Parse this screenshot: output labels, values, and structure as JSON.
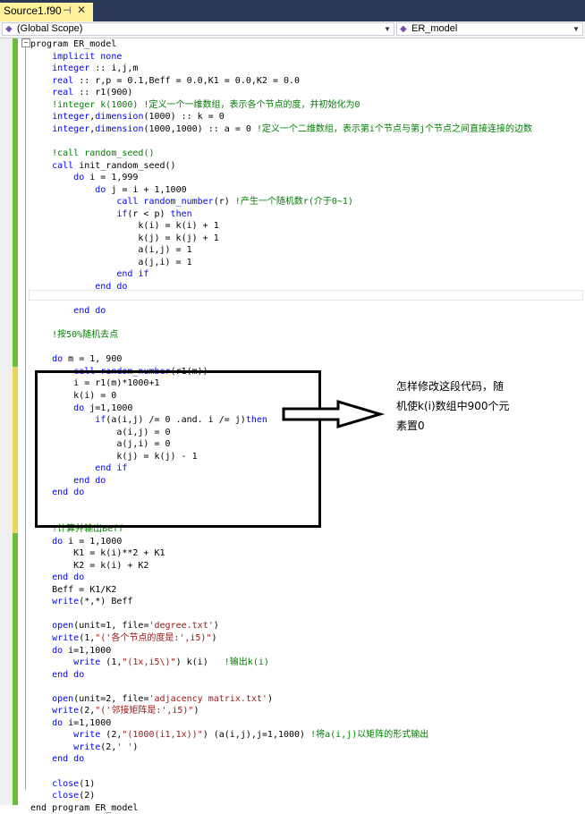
{
  "tab": {
    "title": "Source1.f90",
    "pin_glyph": "⊣",
    "close_glyph": "✕"
  },
  "scope": {
    "left": "(Global Scope)",
    "right": "ER_model"
  },
  "code_lines": [
    [
      {
        "t": "program ER_model"
      }
    ],
    [
      {
        "t": "    "
      },
      {
        "t": "implicit none",
        "c": "kw"
      }
    ],
    [
      {
        "t": "    "
      },
      {
        "t": "integer",
        "c": "kw"
      },
      {
        "t": " :: i,j,m"
      }
    ],
    [
      {
        "t": "    "
      },
      {
        "t": "real",
        "c": "kw"
      },
      {
        "t": " :: r,p = 0.1,Beff = 0.0,K1 = 0.0,K2 = 0.0"
      }
    ],
    [
      {
        "t": "    "
      },
      {
        "t": "real",
        "c": "kw"
      },
      {
        "t": " :: r1(900)"
      }
    ],
    [
      {
        "t": "    "
      },
      {
        "t": "!integer k(1000) !定义一个一维数组，表示各个节点的度，并初始化为0",
        "c": "cm"
      }
    ],
    [
      {
        "t": "    "
      },
      {
        "t": "integer",
        "c": "kw"
      },
      {
        "t": ","
      },
      {
        "t": "dimension",
        "c": "kw"
      },
      {
        "t": "(1000) :: k = 0"
      }
    ],
    [
      {
        "t": "    "
      },
      {
        "t": "integer",
        "c": "kw"
      },
      {
        "t": ","
      },
      {
        "t": "dimension",
        "c": "kw"
      },
      {
        "t": "(1000,1000) :: a = 0 "
      },
      {
        "t": "!定义一个二维数组，表示第i个节点与第j个节点之间直接连接的边数",
        "c": "cm"
      }
    ],
    [],
    [
      {
        "t": "    "
      },
      {
        "t": "!call random_seed()",
        "c": "cm"
      }
    ],
    [
      {
        "t": "    "
      },
      {
        "t": "call",
        "c": "kw"
      },
      {
        "t": " init_random_seed()"
      }
    ],
    [
      {
        "t": "        "
      },
      {
        "t": "do",
        "c": "kw"
      },
      {
        "t": " i = 1,999"
      }
    ],
    [
      {
        "t": "            "
      },
      {
        "t": "do",
        "c": "kw"
      },
      {
        "t": " j = i + 1,1000"
      }
    ],
    [
      {
        "t": "                "
      },
      {
        "t": "call random_number",
        "c": "kw"
      },
      {
        "t": "(r) "
      },
      {
        "t": "!产生一个随机数r(介于0~1)",
        "c": "cm"
      }
    ],
    [
      {
        "t": "                "
      },
      {
        "t": "if",
        "c": "kw"
      },
      {
        "t": "(r < p) "
      },
      {
        "t": "then",
        "c": "kw"
      }
    ],
    [
      {
        "t": "                    k(i) = k(i) + 1"
      }
    ],
    [
      {
        "t": "                    k(j) = k(j) + 1"
      }
    ],
    [
      {
        "t": "                    a(i,j) = 1"
      }
    ],
    [
      {
        "t": "                    a(j,i) = 1"
      }
    ],
    [
      {
        "t": "                "
      },
      {
        "t": "end if",
        "c": "kw"
      }
    ],
    [
      {
        "t": "            "
      },
      {
        "t": "end do",
        "c": "kw"
      }
    ],
    [],
    [
      {
        "t": "        "
      },
      {
        "t": "end do",
        "c": "kw"
      }
    ],
    [],
    [
      {
        "t": "    "
      },
      {
        "t": "!按50%随机去点",
        "c": "cm"
      }
    ],
    [],
    [
      {
        "t": "    "
      },
      {
        "t": "do",
        "c": "kw"
      },
      {
        "t": " m = 1, 900"
      }
    ],
    [
      {
        "t": "        "
      },
      {
        "t": "call random_number",
        "c": "kw"
      },
      {
        "t": "(r1(m))"
      }
    ],
    [
      {
        "t": "        i = r1(m)*1000+1"
      }
    ],
    [
      {
        "t": "        k(i) = 0"
      }
    ],
    [
      {
        "t": "        "
      },
      {
        "t": "do",
        "c": "kw"
      },
      {
        "t": " j=1,1000"
      }
    ],
    [
      {
        "t": "            "
      },
      {
        "t": "if",
        "c": "kw"
      },
      {
        "t": "(a(i,j) /= 0 .and. i /= j)"
      },
      {
        "t": "then",
        "c": "kw"
      }
    ],
    [
      {
        "t": "                a(i,j) = 0"
      }
    ],
    [
      {
        "t": "                a(j,i) = 0"
      }
    ],
    [
      {
        "t": "                k(j) = k(j) - 1"
      }
    ],
    [
      {
        "t": "            "
      },
      {
        "t": "end if",
        "c": "kw"
      }
    ],
    [
      {
        "t": "        "
      },
      {
        "t": "end do",
        "c": "kw"
      }
    ],
    [
      {
        "t": "    "
      },
      {
        "t": "end do",
        "c": "kw"
      }
    ],
    [],
    [],
    [
      {
        "t": "    "
      },
      {
        "t": "!计算并输出Beff",
        "c": "cm"
      }
    ],
    [
      {
        "t": "    "
      },
      {
        "t": "do",
        "c": "kw"
      },
      {
        "t": " i = 1,1000"
      }
    ],
    [
      {
        "t": "        K1 = k(i)**2 + K1"
      }
    ],
    [
      {
        "t": "        K2 = k(i) + K2"
      }
    ],
    [
      {
        "t": "    "
      },
      {
        "t": "end do",
        "c": "kw"
      }
    ],
    [
      {
        "t": "    Beff = K1/K2"
      }
    ],
    [
      {
        "t": "    "
      },
      {
        "t": "write",
        "c": "kw"
      },
      {
        "t": "(*,*) Beff"
      }
    ],
    [],
    [
      {
        "t": "    "
      },
      {
        "t": "open",
        "c": "kw"
      },
      {
        "t": "(unit=1, file="
      },
      {
        "t": "'degree.txt'",
        "c": "st"
      },
      {
        "t": ")"
      }
    ],
    [
      {
        "t": "    "
      },
      {
        "t": "write",
        "c": "kw"
      },
      {
        "t": "(1,"
      },
      {
        "t": "\"('各个节点的度是:',i5)\"",
        "c": "st"
      },
      {
        "t": ")"
      }
    ],
    [
      {
        "t": "    "
      },
      {
        "t": "do",
        "c": "kw"
      },
      {
        "t": " i=1,1000"
      }
    ],
    [
      {
        "t": "        "
      },
      {
        "t": "write",
        "c": "kw"
      },
      {
        "t": " (1,"
      },
      {
        "t": "\"(1x,i5\\)\"",
        "c": "st"
      },
      {
        "t": ") k(i)   "
      },
      {
        "t": "!输出k(i)",
        "c": "cm"
      }
    ],
    [
      {
        "t": "    "
      },
      {
        "t": "end do",
        "c": "kw"
      }
    ],
    [],
    [
      {
        "t": "    "
      },
      {
        "t": "open",
        "c": "kw"
      },
      {
        "t": "(unit=2, file="
      },
      {
        "t": "'adjacency matrix.txt'",
        "c": "st"
      },
      {
        "t": ")"
      }
    ],
    [
      {
        "t": "    "
      },
      {
        "t": "write",
        "c": "kw"
      },
      {
        "t": "(2,"
      },
      {
        "t": "\"('邻接矩阵是:',i5)\"",
        "c": "st"
      },
      {
        "t": ")"
      }
    ],
    [
      {
        "t": "    "
      },
      {
        "t": "do",
        "c": "kw"
      },
      {
        "t": " i=1,1000"
      }
    ],
    [
      {
        "t": "        "
      },
      {
        "t": "write",
        "c": "kw"
      },
      {
        "t": " (2,"
      },
      {
        "t": "\"(1000(i1,1x))\"",
        "c": "st"
      },
      {
        "t": ") (a(i,j),j=1,1000) "
      },
      {
        "t": "!将a(i,j)以矩阵的形式输出",
        "c": "cm"
      }
    ],
    [
      {
        "t": "        "
      },
      {
        "t": "write",
        "c": "kw"
      },
      {
        "t": "(2,"
      },
      {
        "t": "' '",
        "c": "st"
      },
      {
        "t": ")"
      }
    ],
    [
      {
        "t": "    "
      },
      {
        "t": "end do",
        "c": "kw"
      }
    ],
    [],
    [
      {
        "t": "    "
      },
      {
        "t": "close",
        "c": "kw"
      },
      {
        "t": "(1)"
      }
    ],
    [
      {
        "t": "    "
      },
      {
        "t": "close",
        "c": "kw"
      },
      {
        "t": "(2)"
      }
    ],
    [
      {
        "t": "end program ER_model"
      }
    ]
  ],
  "annotation": {
    "line1": "怎样修改这段代码，随",
    "line2": "机使k(i)数组中900个元",
    "line3": "素置0"
  }
}
